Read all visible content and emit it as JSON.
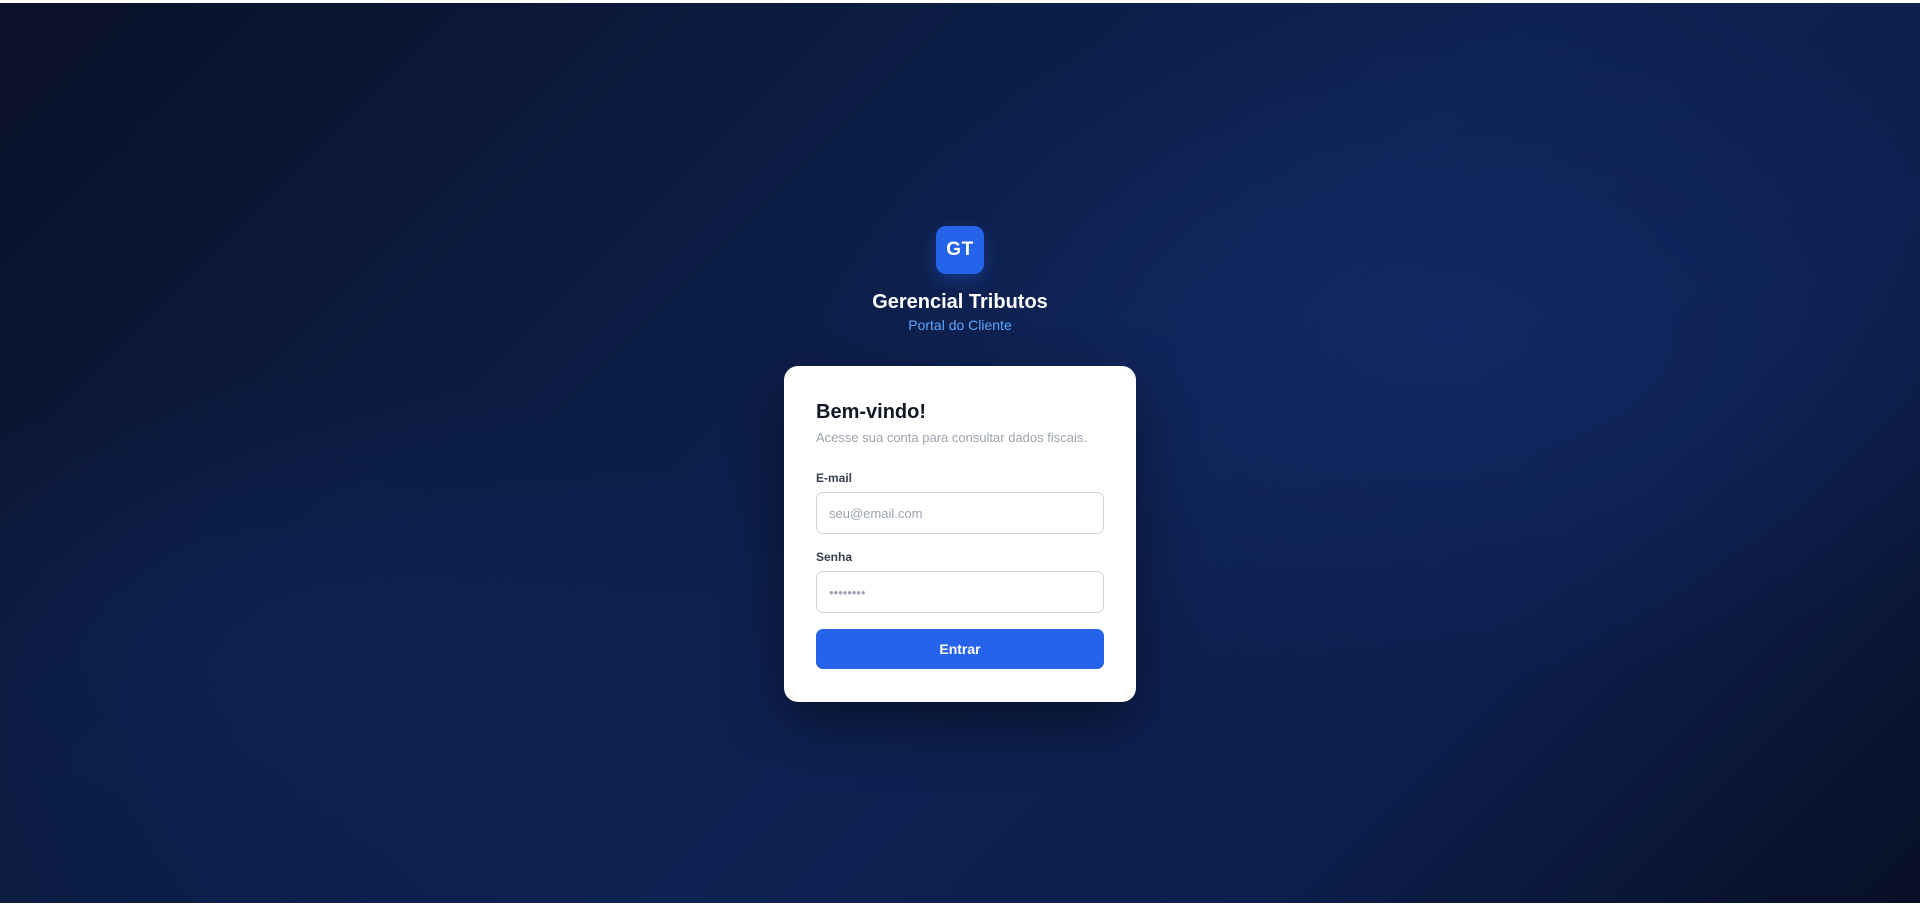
{
  "brand": {
    "logo_text": "GT",
    "title": "Gerencial Tributos",
    "subtitle": "Portal do Cliente"
  },
  "login": {
    "title": "Bem-vindo!",
    "subtitle": "Acesse sua conta para consultar dados fiscais.",
    "email": {
      "label": "E-mail",
      "placeholder": "seu@email.com",
      "value": ""
    },
    "password": {
      "label": "Senha",
      "placeholder": "••••••••",
      "value": ""
    },
    "submit_label": "Entrar"
  },
  "colors": {
    "accent": "#2563eb",
    "subtitle_accent": "#60a5fa",
    "background_dark": "#0a1128",
    "background_mid": "#0e2253",
    "card": "#ffffff"
  }
}
